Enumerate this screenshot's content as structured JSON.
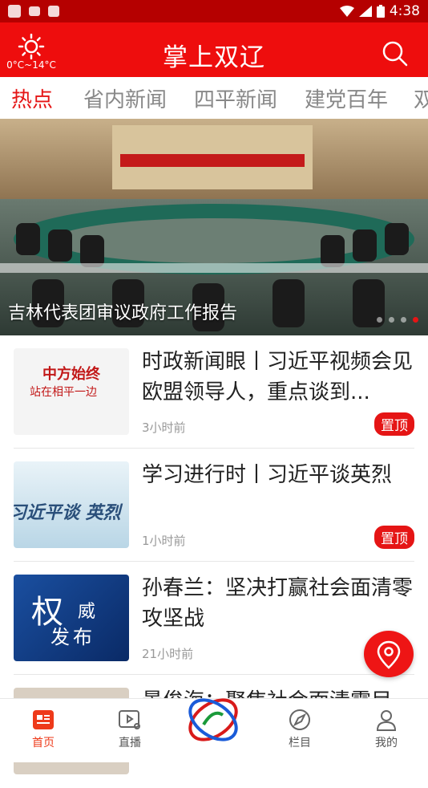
{
  "status_bar": {
    "time": "4:38"
  },
  "header": {
    "title": "掌上双辽",
    "weather": "0°C~14°C"
  },
  "tabs": [
    {
      "label": "热点"
    },
    {
      "label": "省内新闻"
    },
    {
      "label": "四平新闻"
    },
    {
      "label": "建党百年"
    },
    {
      "label": "双"
    }
  ],
  "carousel": {
    "caption": "吉林代表团审议政府工作报告"
  },
  "news": [
    {
      "title": "时政新闻眼丨习近平视频会见欧盟领导人，重点谈到...",
      "time": "3小时前",
      "badge": "置顶",
      "thumb_text_1": "中方始终",
      "thumb_text_2": "站在相平一边"
    },
    {
      "title": "学习进行时丨习近平谈英烈",
      "time": "1小时前",
      "badge": "置顶",
      "thumb_text_1": "习近平谈 英烈"
    },
    {
      "title": "孙春兰：坚决打赢社会面清零攻坚战",
      "time": "21小时前",
      "thumb_text_1": "权",
      "thumb_text_2": "威",
      "thumb_text_3": "发布"
    },
    {
      "title": "景俊海：聚焦社会面清零目"
    }
  ],
  "bottom_nav": [
    {
      "label": "首页"
    },
    {
      "label": "直播"
    },
    {
      "label": ""
    },
    {
      "label": "栏目"
    },
    {
      "label": "我的"
    }
  ],
  "colors": {
    "brand_red": "#ee0d0d",
    "status_bar": "#b50000",
    "active_tab": "#e51515",
    "active_nav": "#ee3a1a"
  }
}
